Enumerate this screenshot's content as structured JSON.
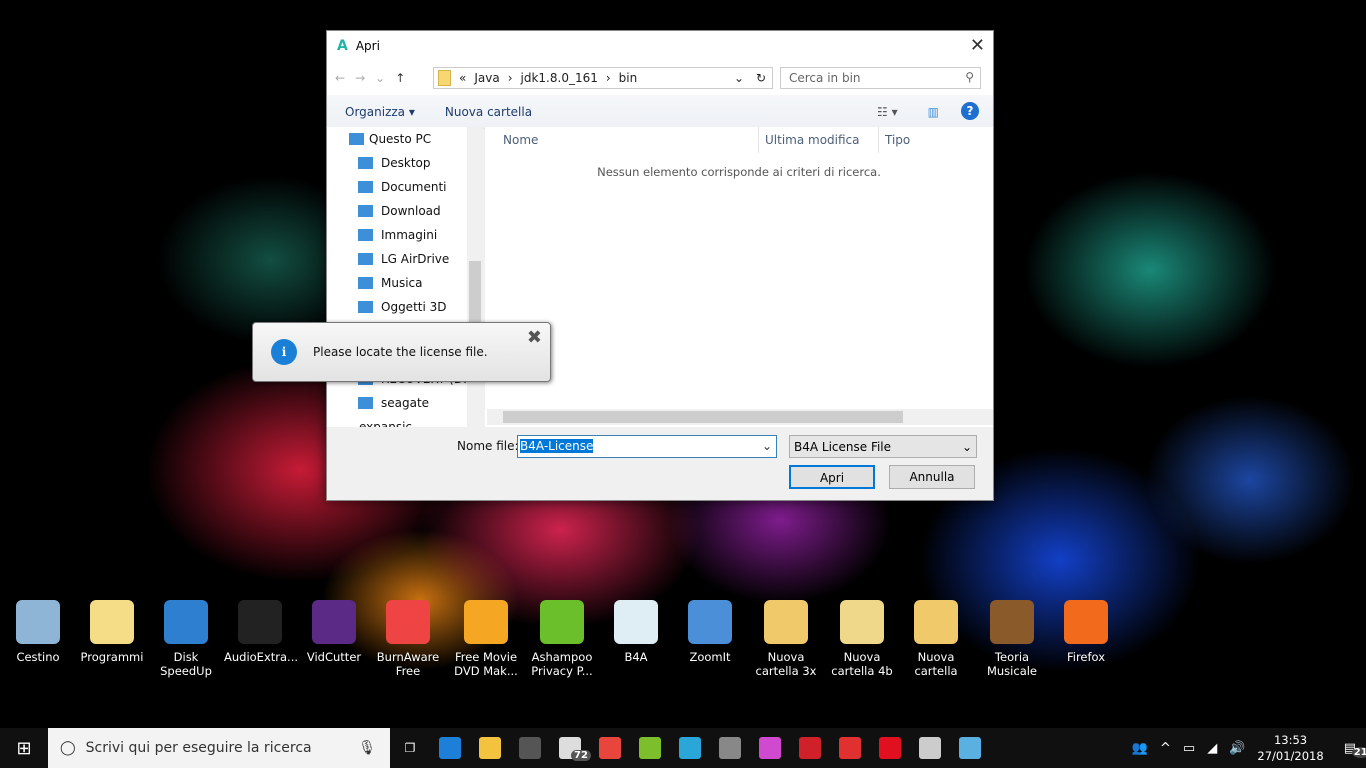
{
  "dialog": {
    "title": "Apri",
    "close": "✕",
    "path": [
      "«",
      "Java",
      "›",
      "jdk1.8.0_161",
      "›",
      "bin"
    ],
    "search_placeholder": "Cerca in bin",
    "toolbar": {
      "organize": "Organizza ▾",
      "new_folder": "Nuova cartella",
      "help": "?"
    },
    "nav_items": [
      "Questo PC",
      "Desktop",
      "Documenti",
      "Download",
      "Immagini",
      "LG AirDrive",
      "Musica",
      "Oggetti 3D",
      "",
      "",
      "RECOVERY (D:)",
      "seagate expansic"
    ],
    "columns": [
      "Nome",
      "Ultima modifica",
      "Tipo"
    ],
    "empty_message": "Nessun elemento corrisponde ai criteri di ricerca.",
    "file_name_label": "Nome file:",
    "file_name_value": "B4A-License",
    "file_type": "B4A License File",
    "open_button": "Apri",
    "cancel_button": "Annulla"
  },
  "tooltip": {
    "message": "Please locate the license file.",
    "close": "✖"
  },
  "desktop_icons": [
    {
      "label": "Cestino",
      "color": "#8fb5d6"
    },
    {
      "label": "Programmi",
      "color": "#f5dc86"
    },
    {
      "label": "Disk SpeedUp",
      "color": "#2f7fd0"
    },
    {
      "label": "AudioExtra...",
      "color": "#222"
    },
    {
      "label": "VidCutter",
      "color": "#5b2a86"
    },
    {
      "label": "BurnAware Free",
      "color": "#e44"
    },
    {
      "label": "Free Movie DVD Mak...",
      "color": "#f5a623"
    },
    {
      "label": "Ashampoo Privacy P...",
      "color": "#6bbf2a"
    },
    {
      "label": "B4A",
      "color": "#dfeef5"
    },
    {
      "label": "ZoomIt",
      "color": "#4a8fd8"
    },
    {
      "label": "Nuova cartella 3x",
      "color": "#f0c96a"
    },
    {
      "label": "Nuova cartella 4b",
      "color": "#f0d88a"
    },
    {
      "label": "Nuova cartella",
      "color": "#f0c96a"
    },
    {
      "label": "Teoria Musicale",
      "color": "#8a5a2a"
    },
    {
      "label": "Firefox",
      "color": "#f26b1d"
    }
  ],
  "taskbar": {
    "search_placeholder": "Scrivi qui per eseguire la ricerca",
    "mail_badge": "72",
    "apps": [
      {
        "name": "edge",
        "color": "#1e7fd8"
      },
      {
        "name": "explorer",
        "color": "#f3c340"
      },
      {
        "name": "store",
        "color": "#555"
      },
      {
        "name": "mail",
        "color": "#ddd"
      },
      {
        "name": "chrome",
        "color": "#e8453c"
      },
      {
        "name": "android",
        "color": "#7cbf2a"
      },
      {
        "name": "app",
        "color": "#2aa6d8"
      },
      {
        "name": "audio",
        "color": "#888"
      },
      {
        "name": "paint",
        "color": "#d04ad0"
      },
      {
        "name": "autocad",
        "color": "#d0202a"
      },
      {
        "name": "kaspersky",
        "color": "#e03030"
      },
      {
        "name": "opera",
        "color": "#e01020"
      },
      {
        "name": "photos",
        "color": "#ccc"
      },
      {
        "name": "notepad",
        "color": "#5ab0e0"
      }
    ],
    "time": "13:53",
    "date": "27/01/2018",
    "notifications": "21"
  }
}
